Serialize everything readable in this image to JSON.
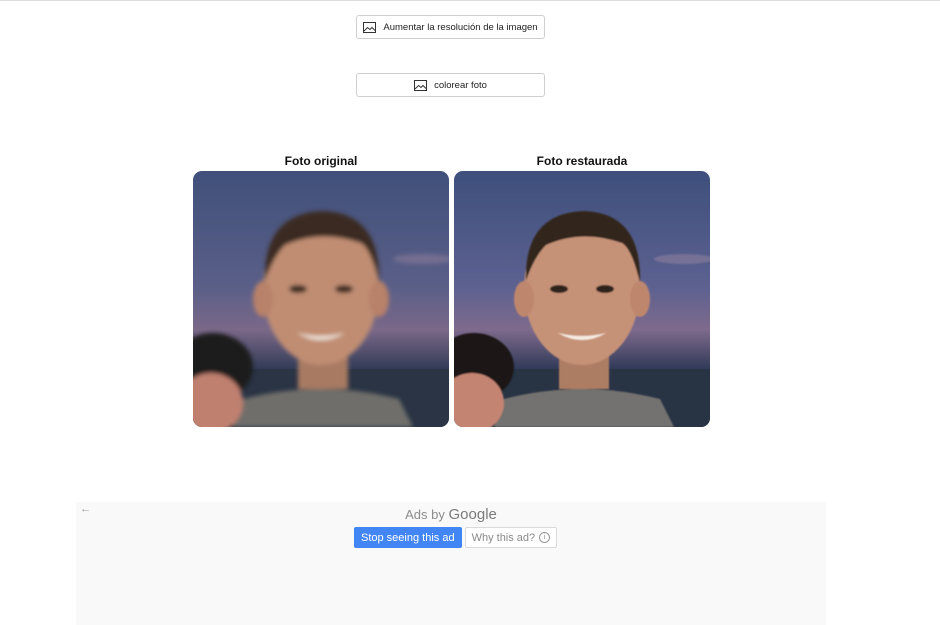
{
  "toolbar": {
    "upscale_label": "Aumentar la resolución de la imagen",
    "colorize_label": "colorear foto",
    "button_icon": "image-icon"
  },
  "comparison": {
    "original_title": "Foto original",
    "restored_title": "Foto restaurada"
  },
  "ads": {
    "back_glyph": "←",
    "ads_by": "Ads by",
    "google": "Google",
    "stop_label": "Stop seeing this ad",
    "why_label": "Why this ad?",
    "info_glyph": "i",
    "stop_color": "#4285f4"
  }
}
